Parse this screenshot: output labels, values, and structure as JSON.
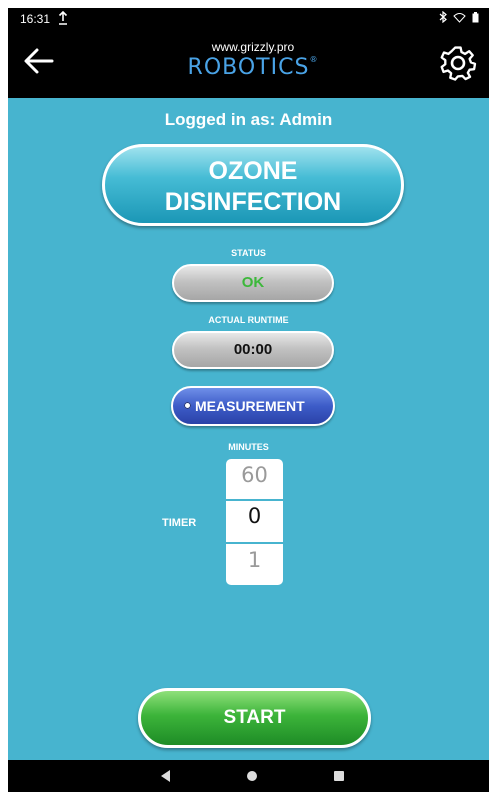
{
  "status_bar": {
    "time": "16:31",
    "upload_icon": "upload-icon",
    "right_icons": [
      "bluetooth-icon",
      "wifi-icon",
      "battery-icon"
    ]
  },
  "app_bar": {
    "back_icon": "arrow-left-icon",
    "logo_url": "www.grizzly.pro",
    "logo_brand": "ROBOTICS",
    "logo_reg": "®",
    "settings_icon": "gear-icon"
  },
  "main": {
    "logged_in": "Logged in as: Admin",
    "title_line1": "OZONE",
    "title_line2": "DISINFECTION",
    "status_label": "STATUS",
    "status_value": "OK",
    "runtime_label": "ACTUAL RUNTIME",
    "runtime_value": "00:00",
    "measurement_label": "MEASUREMENT",
    "minutes_label": "MINUTES",
    "timer_label": "TIMER",
    "picker": {
      "prev": "60",
      "current": "0",
      "next": "1"
    },
    "start_label": "START"
  },
  "colors": {
    "background": "#47b4cf",
    "status_ok": "#3cb83a",
    "measurement_button": "#3d5cc8",
    "start_button": "#3cb43a",
    "brand": "#4aa3e6"
  },
  "nav_bar": {
    "back_icon": "nav-back-icon",
    "home_icon": "nav-home-icon",
    "recent_icon": "nav-recent-icon"
  }
}
